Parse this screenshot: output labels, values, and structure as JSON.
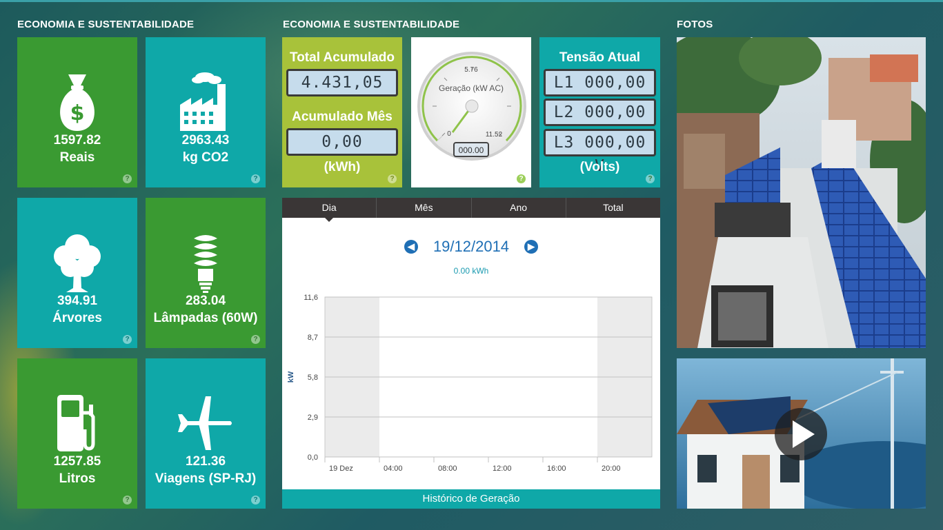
{
  "sections": {
    "left_title": "ECONOMIA E SUSTENTABILIDADE",
    "middle_title": "ECONOMIA E SUSTENTABILIDADE",
    "right_title": "FOTOS"
  },
  "tiles": [
    {
      "value": "1597.82",
      "unit": "Reais",
      "icon": "money-bag-icon",
      "color": "#3a9a32"
    },
    {
      "value": "2963.43",
      "unit": "kg CO2",
      "icon": "factory-icon",
      "color": "#0fa8a8"
    },
    {
      "value": "394.91",
      "unit": "Árvores",
      "icon": "tree-icon",
      "color": "#0fa8a8"
    },
    {
      "value": "283.04",
      "unit": "Lâmpadas (60W)",
      "icon": "lightbulb-icon",
      "color": "#3a9a32"
    },
    {
      "value": "1257.85",
      "unit": "Litros",
      "icon": "fuel-pump-icon",
      "color": "#3a9a32"
    },
    {
      "value": "121.36",
      "unit": "Viagens (SP-RJ)",
      "icon": "airplane-icon",
      "color": "#0fa8a8"
    }
  ],
  "help_symbol": "?",
  "accumulated": {
    "total_label": "Total Acumulado",
    "total_value": "4.431,05",
    "month_label": "Acumulado Mês",
    "month_value": "0,00",
    "unit": "(kWh)"
  },
  "gauge": {
    "label": "Geração (kW AC)",
    "min": "0",
    "mid": "5.76",
    "max": "11.52",
    "readout": "000.00",
    "value": 0
  },
  "voltage": {
    "title": "Tensão Atual",
    "l1": "L1 000,00 V",
    "l2": "L2 000,00 V",
    "l3": "L3 000,00 V",
    "unit": "(Volts)"
  },
  "tabs": [
    "Dia",
    "Mês",
    "Ano",
    "Total"
  ],
  "active_tab": "Dia",
  "date_nav": {
    "prev": "◀",
    "date": "19/12/2014",
    "next": "▶",
    "energy": "0.00 kWh"
  },
  "chart_data": {
    "type": "area",
    "ylabel": "kW",
    "ylim": [
      0,
      11.6
    ],
    "yticks": [
      "0,0",
      "2,9",
      "5,8",
      "8,7",
      "11,6"
    ],
    "xticks": [
      "19 Dez",
      "04:00",
      "08:00",
      "12:00",
      "16:00",
      "20:00"
    ],
    "series": [
      {
        "values": []
      }
    ],
    "grid": true,
    "night_bands": true
  },
  "chart_footer": "Histórico de Geração",
  "colors": {
    "green": "#3a9a32",
    "teal": "#0fa8a8",
    "lime": "#a8c23a",
    "lcd_bg": "#c6dcec",
    "nav_blue": "#1f6fb5"
  }
}
